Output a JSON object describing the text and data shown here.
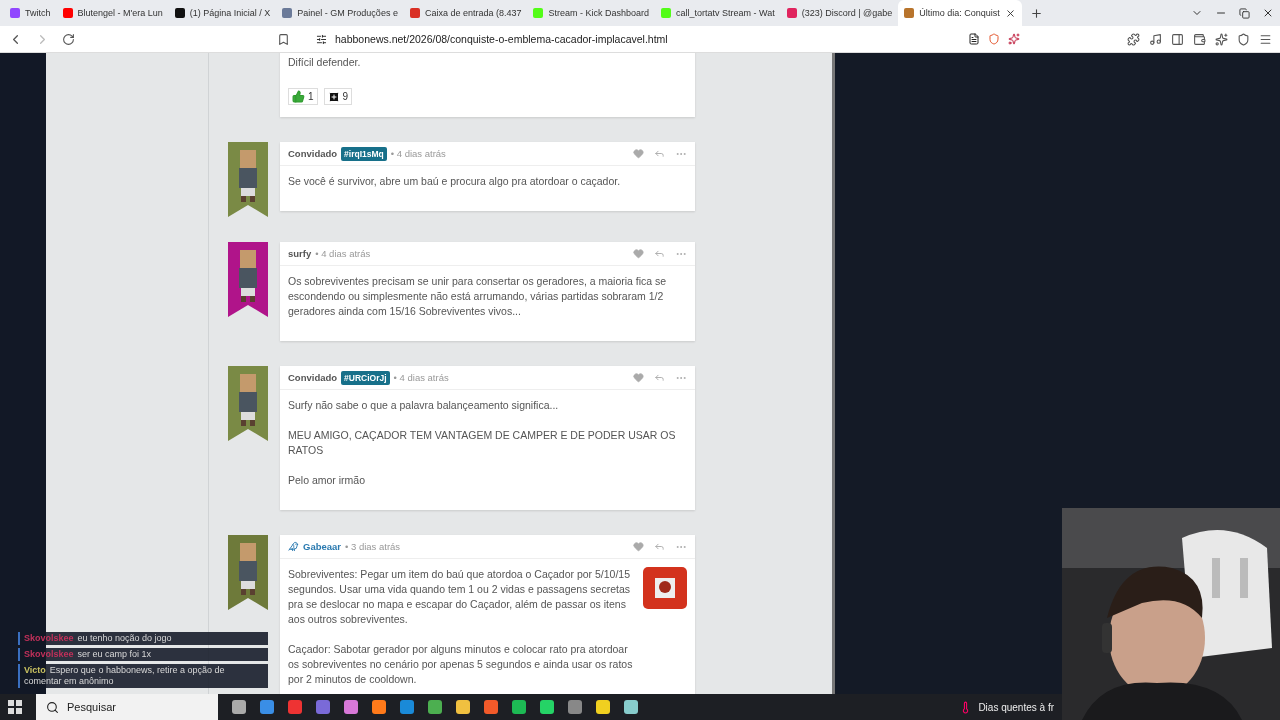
{
  "browser": {
    "tabs": [
      {
        "title": "Twitch",
        "selected": false,
        "color": "#9146ff"
      },
      {
        "title": "Blutengel - M'era Lun",
        "selected": false,
        "color": "#ff0000"
      },
      {
        "title": "(1) Página Inicial / X",
        "selected": false,
        "color": "#111111"
      },
      {
        "title": "Painel - GM Produções e",
        "selected": false,
        "color": "#6b7a99"
      },
      {
        "title": "Caixa de entrada (8.437",
        "selected": false,
        "color": "#d93025"
      },
      {
        "title": "Stream - Kick Dashboard",
        "selected": false,
        "color": "#53fc18"
      },
      {
        "title": "call_tortatv Stream - Wat",
        "selected": false,
        "color": "#53fc18"
      },
      {
        "title": "(323) Discord | @gabe",
        "selected": false,
        "color": "#e0245e"
      },
      {
        "title": "Último dia: Conquist",
        "selected": true,
        "color": "#b8742c"
      }
    ],
    "url": "habbonews.net/2026/08/conquiste-o-emblema-cacador-implacavel.html"
  },
  "comments": [
    {
      "kind": "partial",
      "paragraphs": [
        "Difícil defender."
      ],
      "reactions": [
        {
          "kind": "like",
          "count": "1"
        },
        {
          "kind": "plus",
          "count": "9"
        }
      ]
    },
    {
      "kind": "guest",
      "author": "Convidado",
      "tag": "#irqI1sMq",
      "time": "• 4 dias atrás",
      "color": "#7a8a45",
      "paragraphs": [
        "Se você é survivor, abre um baú e procura algo pra atordoar o caçador."
      ]
    },
    {
      "kind": "user",
      "author": "surfy",
      "time": "• 4 dias atrás",
      "color": "#b0148a",
      "paragraphs": [
        "Os sobreviventes precisam se unir para consertar os geradores, a maioria fica se escondendo ou simplesmente não está arrumando, várias partidas sobraram 1/2 geradores ainda com 15/16 Sobreviventes vivos..."
      ]
    },
    {
      "kind": "guest",
      "author": "Convidado",
      "tag": "#URCiOrJj",
      "time": "• 4 dias atrás",
      "color": "#7a8a45",
      "paragraphs": [
        "Surfy não sabe o que a palavra balançeamento significa...",
        "MEU AMIGO, CAÇADOR TEM VANTAGEM DE CAMPER E DE PODER USAR OS RATOS",
        "Pelo amor irmão"
      ]
    },
    {
      "kind": "staff",
      "author": "Gabeaar",
      "time": "• 3 dias atrás",
      "color": "#6e7a3a",
      "paragraphs": [
        "Sobreviventes: Pegar um item do baú que atordoa o Caçador por 5/10/15 segundos. Usar uma vida quando tem 1 ou 2 vidas e passagens secretas pra se deslocar no mapa e escapar do Caçador, além de passar os itens aos outros sobreviventes.",
        "Caçador: Sabotar gerador por alguns minutos e colocar rato pra atordoar os sobreviventes no cenário por apenas 5 segundos e ainda usar os ratos por 2 minutos de cooldown."
      ]
    }
  ],
  "chat": [
    {
      "name": "Skovolskee",
      "text": "eu tenho noção do jogo",
      "color": "#c0305a"
    },
    {
      "name": "Skovolskee",
      "text": "ser eu camp foi 1x",
      "color": "#c0305a"
    },
    {
      "name": "Victo",
      "text": "Espero que o habbonews, retire a opção de comentar em anônimo",
      "color": "#c8c060"
    }
  ],
  "taskbar": {
    "search": {
      "placeholder": "Pesquisar"
    },
    "weather": "Dias quentes à fr"
  }
}
